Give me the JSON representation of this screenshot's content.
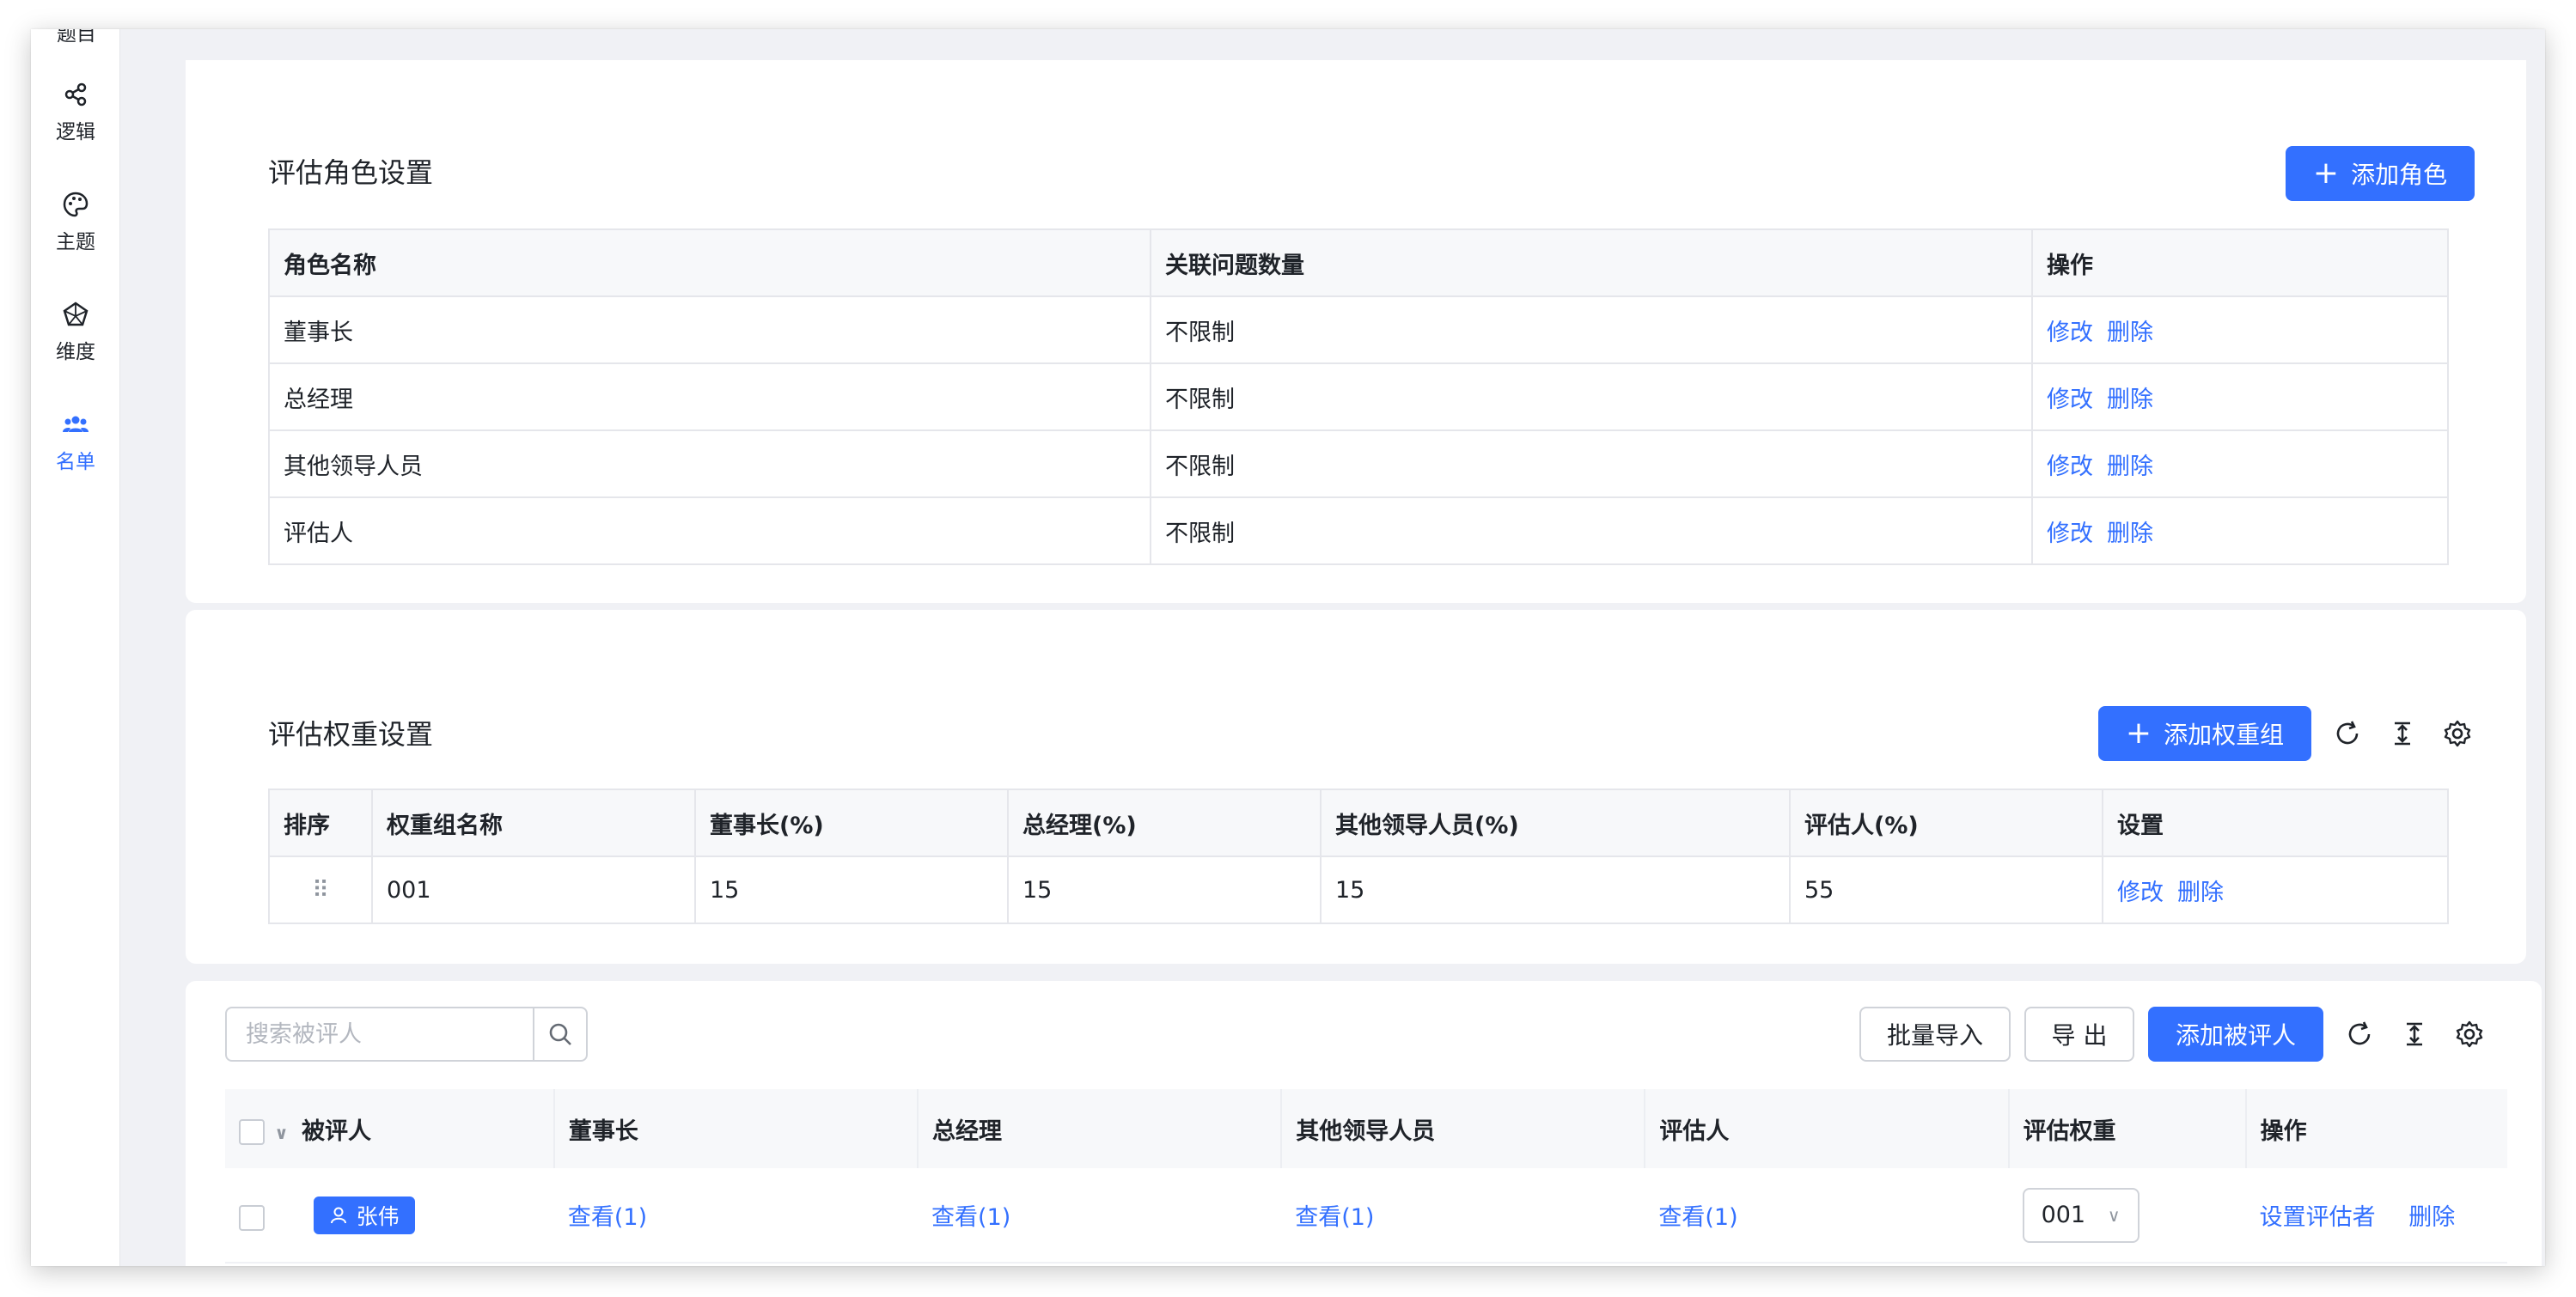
{
  "sidebar": {
    "clipped_label": "题目",
    "items": [
      {
        "label": "逻辑",
        "icon": "logic-icon"
      },
      {
        "label": "主题",
        "icon": "palette-icon"
      },
      {
        "label": "维度",
        "icon": "dimension-icon"
      },
      {
        "label": "名单",
        "icon": "users-icon",
        "active": true
      }
    ]
  },
  "roles": {
    "title": "评估角色设置",
    "add_button": "添加角色",
    "headers": [
      "角色名称",
      "关联问题数量",
      "操作"
    ],
    "rows": [
      {
        "name": "董事长",
        "limit": "不限制"
      },
      {
        "name": "总经理",
        "limit": "不限制"
      },
      {
        "name": "其他领导人员",
        "limit": "不限制"
      },
      {
        "name": "评估人",
        "limit": "不限制"
      }
    ],
    "edit_label": "修改",
    "delete_label": "删除"
  },
  "weights": {
    "title": "评估权重设置",
    "add_button": "添加权重组",
    "headers": [
      "排序",
      "权重组名称",
      "董事长(%)",
      "总经理(%)",
      "其他领导人员(%)",
      "评估人(%)",
      "设置"
    ],
    "rows": [
      {
        "drag": "⠿",
        "name": "001",
        "chairman": "15",
        "gm": "15",
        "other": "15",
        "evaluator": "55"
      }
    ],
    "edit_label": "修改",
    "delete_label": "删除"
  },
  "evaluatees": {
    "search_placeholder": "搜索被评人",
    "import_button": "批量导入",
    "export_button": "导 出",
    "add_button": "添加被评人",
    "headers": [
      "被评人",
      "董事长",
      "总经理",
      "其他领导人员",
      "评估人",
      "评估权重",
      "操作"
    ],
    "rows": [
      {
        "name": "张伟",
        "chairman": "查看(1)",
        "gm": "查看(1)",
        "other": "查看(1)",
        "evaluator": "查看(1)",
        "weight": "001",
        "set_label": "设置评估者",
        "delete_label": "删除"
      }
    ]
  },
  "colors": {
    "accent": "#3370ff",
    "background": "#f0f1f5"
  }
}
